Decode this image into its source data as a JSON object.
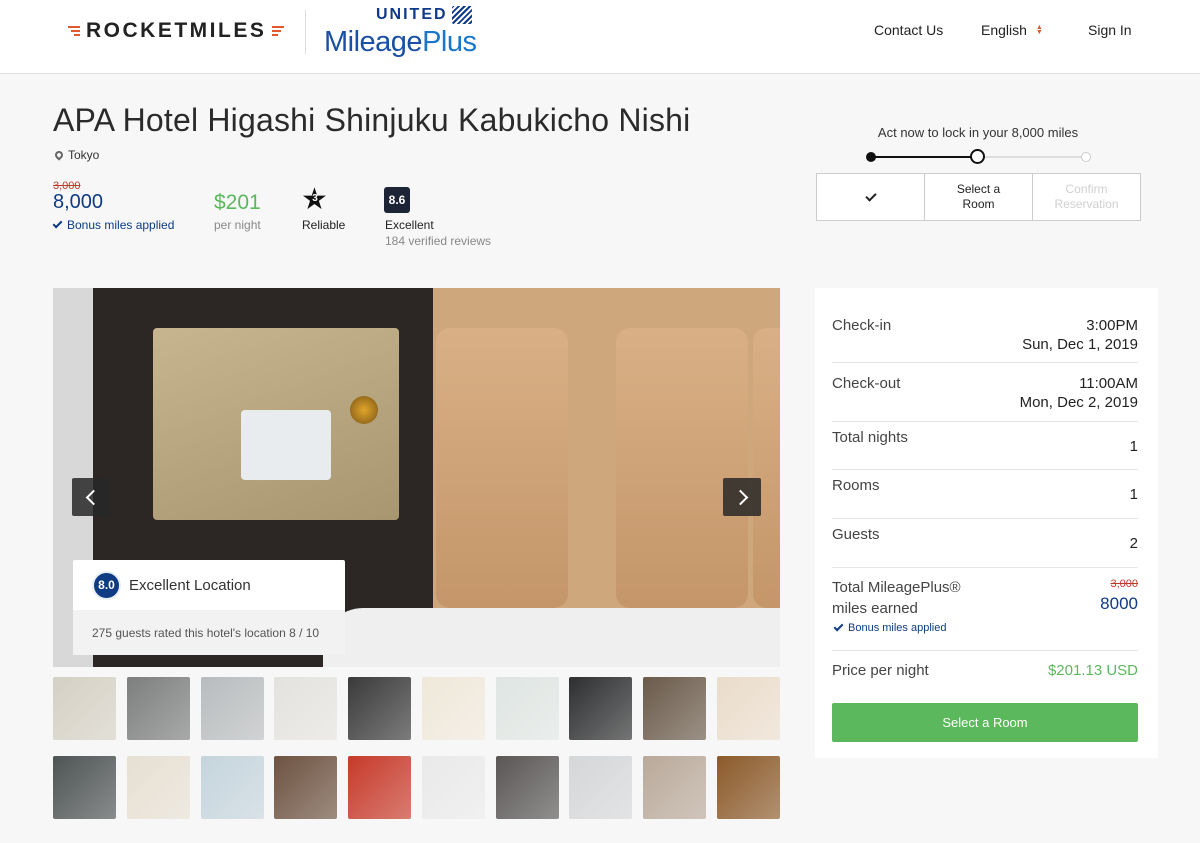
{
  "header": {
    "brand": "ROCKETMILES",
    "partner_top": "UNITED",
    "partner_bottom_a": "Mileage",
    "partner_bottom_b": "Plus",
    "nav": {
      "contact": "Contact Us",
      "language": "English",
      "sign_in": "Sign In"
    }
  },
  "hotel": {
    "name": "APA Hotel Higashi Shinjuku Kabukicho Nishi",
    "location": "Tokyo",
    "miles_original": "3,000",
    "miles_bonus": "8,000",
    "bonus_text": "Bonus miles applied",
    "price": "$201",
    "price_unit": "per night",
    "star_rating": "3",
    "star_label": "Reliable",
    "score": "8.6",
    "score_label": "Excellent",
    "reviews": "184 verified reviews"
  },
  "progress": {
    "heading": "Act now to lock in your 8,000 miles",
    "steps": [
      "",
      "Select a Room",
      "Confirm Reservation"
    ]
  },
  "gallery": {
    "location_score": "8.0",
    "location_title": "Excellent Location",
    "location_caption": "275 guests rated this hotel's location 8 / 10",
    "thumb_colors_row1": [
      "#d4d0c4",
      "#7d7e7e",
      "#b9bcbe",
      "#e4e2de",
      "#3a3a3a",
      "#efe8da",
      "#dfe5e2",
      "#2e2f30",
      "#6a5a4a",
      "#eadccb"
    ],
    "thumb_colors_row2": [
      "#4e5354",
      "#e6dfd2",
      "#c5d4dc",
      "#6d5240",
      "#c63a2a",
      "#e9e9e9",
      "#5a5656",
      "#d4d6d8",
      "#b9a99a",
      "#8b5a2a"
    ]
  },
  "details": {
    "checkin_label": "Check-in",
    "checkin_time": "3:00PM",
    "checkin_date": "Sun, Dec 1, 2019",
    "checkout_label": "Check-out",
    "checkout_time": "11:00AM",
    "checkout_date": "Mon, Dec 2, 2019",
    "nights_label": "Total nights",
    "nights": "1",
    "rooms_label": "Rooms",
    "rooms": "1",
    "guests_label": "Guests",
    "guests": "2",
    "miles_label": "Total MileagePlus® miles earned",
    "miles_old": "3,000",
    "miles_new": "8000",
    "miles_bonus": "Bonus miles applied",
    "price_label": "Price per night",
    "price": "$201.13 USD",
    "cta": "Select a Room"
  },
  "colors": {
    "accent_green": "#5cb85c",
    "united_blue": "#0e3b82",
    "rocket_orange": "#e05a2b"
  }
}
